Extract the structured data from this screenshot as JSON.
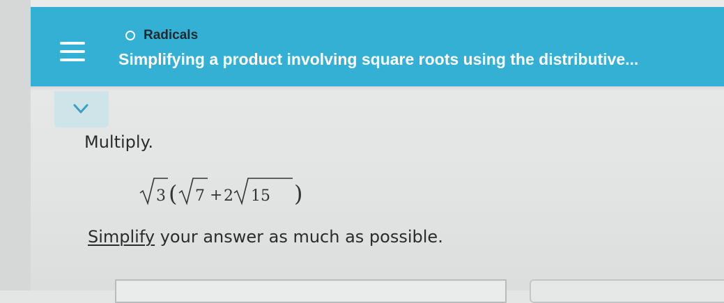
{
  "header": {
    "topic": "Radicals",
    "subtitle": "Simplifying a product involving square roots using the distributive..."
  },
  "menu": {
    "icon": "hamburger-menu-icon"
  },
  "collapse": {
    "icon": "chevron-down-icon"
  },
  "problem": {
    "instruction": "Multiply.",
    "expression": {
      "outer_radicand": "3",
      "open_paren": "(",
      "term1_radicand": "7",
      "operator": "+",
      "coefficient": "2",
      "term2_radicand": "15",
      "close_paren": ")"
    },
    "hint_link": "Simplify",
    "hint_rest": " your answer as much as possible."
  },
  "colors": {
    "header_bg": "#33b0d4",
    "tab_bg": "#cfe4e8",
    "text": "#2b2b2b"
  }
}
